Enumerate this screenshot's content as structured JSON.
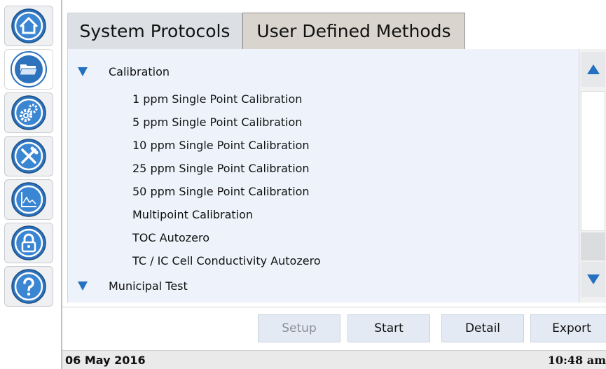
{
  "tabs": [
    {
      "label": "System Protocols",
      "selected": true
    },
    {
      "label": "User Defined Methods",
      "selected": false
    }
  ],
  "sidebar": {
    "items": [
      {
        "name": "home",
        "icon": "home-icon"
      },
      {
        "name": "methods",
        "icon": "folder-icon",
        "active": true
      },
      {
        "name": "setup",
        "icon": "gears-icon"
      },
      {
        "name": "maintenance",
        "icon": "tools-icon"
      },
      {
        "name": "data",
        "icon": "chart-icon"
      },
      {
        "name": "security",
        "icon": "lock-icon"
      },
      {
        "name": "help",
        "icon": "help-icon"
      }
    ]
  },
  "tree": {
    "groups": [
      {
        "label": "Calibration",
        "items": [
          "1 ppm Single Point Calibration",
          "5 ppm Single Point Calibration",
          "10 ppm Single Point Calibration",
          "25 ppm Single Point Calibration",
          "50 ppm Single Point Calibration",
          "Multipoint Calibration",
          "TOC Autozero",
          "TC / IC Cell Conductivity Autozero"
        ]
      },
      {
        "label": "Municipal Test",
        "items": []
      }
    ]
  },
  "actions": {
    "setup": "Setup",
    "start": "Start",
    "detail": "Detail",
    "export": "Export"
  },
  "status": {
    "date": "06 May 2016",
    "time": "10:48 am"
  },
  "colors": {
    "accent": "#2371c0",
    "panel": "#eef3fb"
  }
}
